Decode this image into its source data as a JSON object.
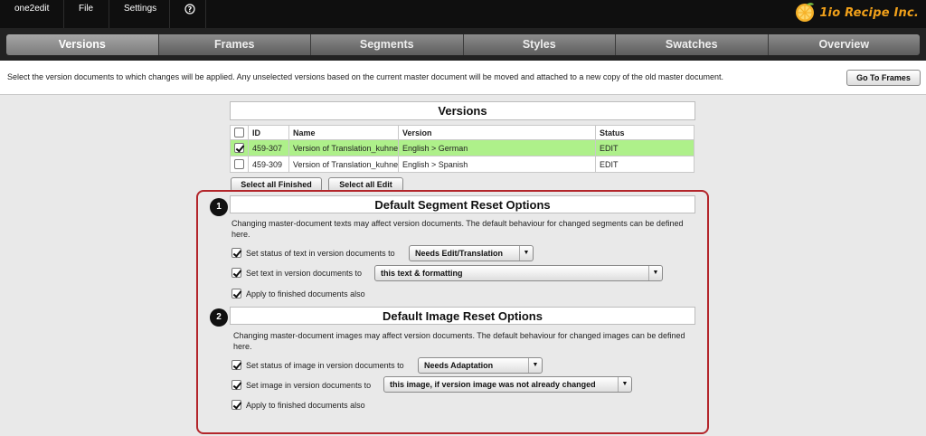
{
  "menubar": {
    "items": [
      "one2edit",
      "File",
      "Settings"
    ],
    "help_icon": "help-circle-icon",
    "brand": "1io Recipe Inc."
  },
  "steps": [
    "Versions",
    "Frames",
    "Segments",
    "Styles",
    "Swatches",
    "Overview"
  ],
  "active_step": "Versions",
  "info": {
    "text": "Select the version documents to which changes will be applied. Any unselected versions based on the current master document will be moved and attached to a new copy of the old master document.",
    "goto_button": "Go To Frames"
  },
  "versions": {
    "title": "Versions",
    "columns": [
      "ID",
      "Name",
      "Version",
      "Status"
    ],
    "rows": [
      {
        "checked": true,
        "id": "459-307",
        "name": "Version of Translation_kuhne",
        "version": "English > German",
        "status": "EDIT"
      },
      {
        "checked": false,
        "id": "459-309",
        "name": "Version of Translation_kuhne",
        "version": "English > Spanish",
        "status": "EDIT"
      }
    ],
    "select_finished": "Select all Finished",
    "select_edit": "Select all Edit"
  },
  "segment_options": {
    "badge": "1",
    "title": "Default Segment Reset Options",
    "description": "Changing master-document texts may affect version documents. The default behaviour for changed segments can be defined here.",
    "opt1_label": "Set status of text in version documents to",
    "opt1_value": "Needs Edit/Translation",
    "opt2_label": "Set text in version documents to",
    "opt2_value": "this text & formatting",
    "opt3_label": "Apply to finished documents also"
  },
  "image_options": {
    "badge": "2",
    "title": "Default Image Reset Options",
    "description": "Changing master-document images may affect version documents. The default behaviour for changed images can be defined here.",
    "opt1_label": "Set status of image in version documents to",
    "opt1_value": "Needs Adaptation",
    "opt2_label": "Set image in version documents to",
    "opt2_value": "this image, if version image was not already changed",
    "opt3_label": "Apply to finished documents also"
  },
  "colors": {
    "selected_row": "#aef08a",
    "highlight_frame": "#b3262b",
    "brand": "#f0a01a"
  }
}
